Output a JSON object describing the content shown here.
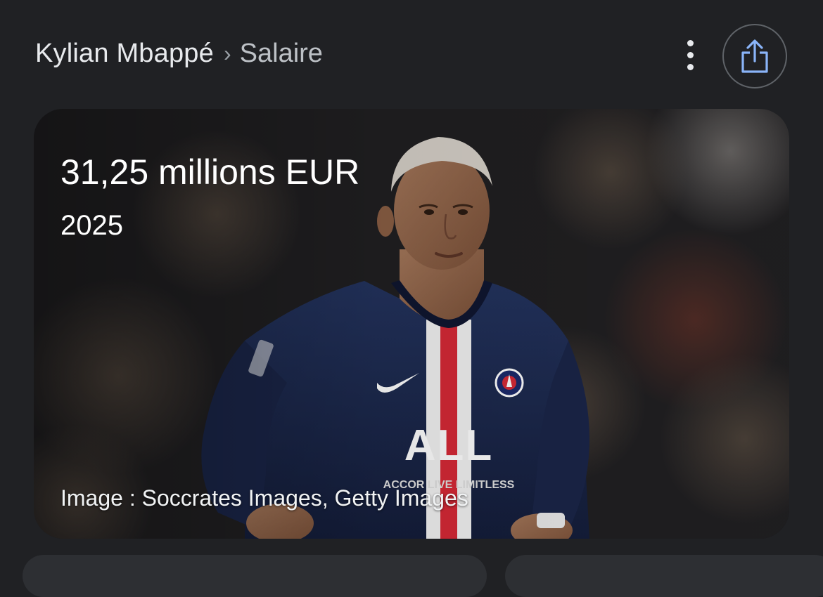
{
  "header": {
    "breadcrumb_entity": "Kylian Mbappé",
    "breadcrumb_separator": "›",
    "breadcrumb_current": "Salaire",
    "more_icon": "more-vert-icon",
    "share_icon": "share-icon"
  },
  "card": {
    "salary": "31,25 millions EUR",
    "year": "2025",
    "credit": "Image : Soccrates Images, Getty Images",
    "sponsor_text": "ALL",
    "sponsor_sub": "ACCOR LIVE LIMITLESS"
  },
  "colors": {
    "background": "#202124",
    "text_primary": "#e8eaed",
    "text_secondary": "#bdc1c6",
    "share_icon": "#8ab4f8",
    "jersey_navy": "#1b2a52",
    "jersey_red": "#d62936"
  }
}
